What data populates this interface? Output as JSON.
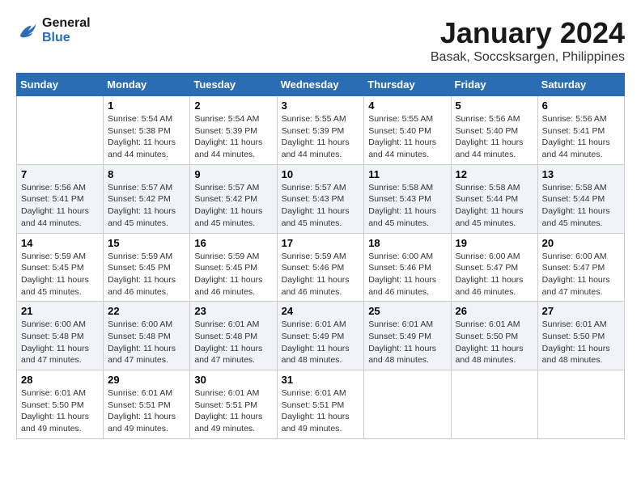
{
  "logo": {
    "line1": "General",
    "line2": "Blue"
  },
  "title": "January 2024",
  "location": "Basak, Soccsksargen, Philippines",
  "days_header": [
    "Sunday",
    "Monday",
    "Tuesday",
    "Wednesday",
    "Thursday",
    "Friday",
    "Saturday"
  ],
  "weeks": [
    [
      {
        "day": "",
        "sunrise": "",
        "sunset": "",
        "daylight": ""
      },
      {
        "day": "1",
        "sunrise": "Sunrise: 5:54 AM",
        "sunset": "Sunset: 5:38 PM",
        "daylight": "Daylight: 11 hours and 44 minutes."
      },
      {
        "day": "2",
        "sunrise": "Sunrise: 5:54 AM",
        "sunset": "Sunset: 5:39 PM",
        "daylight": "Daylight: 11 hours and 44 minutes."
      },
      {
        "day": "3",
        "sunrise": "Sunrise: 5:55 AM",
        "sunset": "Sunset: 5:39 PM",
        "daylight": "Daylight: 11 hours and 44 minutes."
      },
      {
        "day": "4",
        "sunrise": "Sunrise: 5:55 AM",
        "sunset": "Sunset: 5:40 PM",
        "daylight": "Daylight: 11 hours and 44 minutes."
      },
      {
        "day": "5",
        "sunrise": "Sunrise: 5:56 AM",
        "sunset": "Sunset: 5:40 PM",
        "daylight": "Daylight: 11 hours and 44 minutes."
      },
      {
        "day": "6",
        "sunrise": "Sunrise: 5:56 AM",
        "sunset": "Sunset: 5:41 PM",
        "daylight": "Daylight: 11 hours and 44 minutes."
      }
    ],
    [
      {
        "day": "7",
        "sunrise": "Sunrise: 5:56 AM",
        "sunset": "Sunset: 5:41 PM",
        "daylight": "Daylight: 11 hours and 44 minutes."
      },
      {
        "day": "8",
        "sunrise": "Sunrise: 5:57 AM",
        "sunset": "Sunset: 5:42 PM",
        "daylight": "Daylight: 11 hours and 45 minutes."
      },
      {
        "day": "9",
        "sunrise": "Sunrise: 5:57 AM",
        "sunset": "Sunset: 5:42 PM",
        "daylight": "Daylight: 11 hours and 45 minutes."
      },
      {
        "day": "10",
        "sunrise": "Sunrise: 5:57 AM",
        "sunset": "Sunset: 5:43 PM",
        "daylight": "Daylight: 11 hours and 45 minutes."
      },
      {
        "day": "11",
        "sunrise": "Sunrise: 5:58 AM",
        "sunset": "Sunset: 5:43 PM",
        "daylight": "Daylight: 11 hours and 45 minutes."
      },
      {
        "day": "12",
        "sunrise": "Sunrise: 5:58 AM",
        "sunset": "Sunset: 5:44 PM",
        "daylight": "Daylight: 11 hours and 45 minutes."
      },
      {
        "day": "13",
        "sunrise": "Sunrise: 5:58 AM",
        "sunset": "Sunset: 5:44 PM",
        "daylight": "Daylight: 11 hours and 45 minutes."
      }
    ],
    [
      {
        "day": "14",
        "sunrise": "Sunrise: 5:59 AM",
        "sunset": "Sunset: 5:45 PM",
        "daylight": "Daylight: 11 hours and 45 minutes."
      },
      {
        "day": "15",
        "sunrise": "Sunrise: 5:59 AM",
        "sunset": "Sunset: 5:45 PM",
        "daylight": "Daylight: 11 hours and 46 minutes."
      },
      {
        "day": "16",
        "sunrise": "Sunrise: 5:59 AM",
        "sunset": "Sunset: 5:45 PM",
        "daylight": "Daylight: 11 hours and 46 minutes."
      },
      {
        "day": "17",
        "sunrise": "Sunrise: 5:59 AM",
        "sunset": "Sunset: 5:46 PM",
        "daylight": "Daylight: 11 hours and 46 minutes."
      },
      {
        "day": "18",
        "sunrise": "Sunrise: 6:00 AM",
        "sunset": "Sunset: 5:46 PM",
        "daylight": "Daylight: 11 hours and 46 minutes."
      },
      {
        "day": "19",
        "sunrise": "Sunrise: 6:00 AM",
        "sunset": "Sunset: 5:47 PM",
        "daylight": "Daylight: 11 hours and 46 minutes."
      },
      {
        "day": "20",
        "sunrise": "Sunrise: 6:00 AM",
        "sunset": "Sunset: 5:47 PM",
        "daylight": "Daylight: 11 hours and 47 minutes."
      }
    ],
    [
      {
        "day": "21",
        "sunrise": "Sunrise: 6:00 AM",
        "sunset": "Sunset: 5:48 PM",
        "daylight": "Daylight: 11 hours and 47 minutes."
      },
      {
        "day": "22",
        "sunrise": "Sunrise: 6:00 AM",
        "sunset": "Sunset: 5:48 PM",
        "daylight": "Daylight: 11 hours and 47 minutes."
      },
      {
        "day": "23",
        "sunrise": "Sunrise: 6:01 AM",
        "sunset": "Sunset: 5:48 PM",
        "daylight": "Daylight: 11 hours and 47 minutes."
      },
      {
        "day": "24",
        "sunrise": "Sunrise: 6:01 AM",
        "sunset": "Sunset: 5:49 PM",
        "daylight": "Daylight: 11 hours and 48 minutes."
      },
      {
        "day": "25",
        "sunrise": "Sunrise: 6:01 AM",
        "sunset": "Sunset: 5:49 PM",
        "daylight": "Daylight: 11 hours and 48 minutes."
      },
      {
        "day": "26",
        "sunrise": "Sunrise: 6:01 AM",
        "sunset": "Sunset: 5:50 PM",
        "daylight": "Daylight: 11 hours and 48 minutes."
      },
      {
        "day": "27",
        "sunrise": "Sunrise: 6:01 AM",
        "sunset": "Sunset: 5:50 PM",
        "daylight": "Daylight: 11 hours and 48 minutes."
      }
    ],
    [
      {
        "day": "28",
        "sunrise": "Sunrise: 6:01 AM",
        "sunset": "Sunset: 5:50 PM",
        "daylight": "Daylight: 11 hours and 49 minutes."
      },
      {
        "day": "29",
        "sunrise": "Sunrise: 6:01 AM",
        "sunset": "Sunset: 5:51 PM",
        "daylight": "Daylight: 11 hours and 49 minutes."
      },
      {
        "day": "30",
        "sunrise": "Sunrise: 6:01 AM",
        "sunset": "Sunset: 5:51 PM",
        "daylight": "Daylight: 11 hours and 49 minutes."
      },
      {
        "day": "31",
        "sunrise": "Sunrise: 6:01 AM",
        "sunset": "Sunset: 5:51 PM",
        "daylight": "Daylight: 11 hours and 49 minutes."
      },
      {
        "day": "",
        "sunrise": "",
        "sunset": "",
        "daylight": ""
      },
      {
        "day": "",
        "sunrise": "",
        "sunset": "",
        "daylight": ""
      },
      {
        "day": "",
        "sunrise": "",
        "sunset": "",
        "daylight": ""
      }
    ]
  ]
}
